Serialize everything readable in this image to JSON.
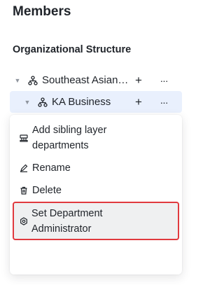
{
  "header": {
    "title": "Members"
  },
  "section": {
    "title": "Organizational Structure"
  },
  "tree": {
    "root": {
      "label": "Southeast Asian ...",
      "add": "+",
      "more": "···"
    },
    "child": {
      "label": "KA Business",
      "add": "+",
      "more": "···"
    }
  },
  "menu": {
    "items": [
      {
        "label_line1": "Add sibling layer",
        "label_line2": "departments",
        "icon": "sibling-department-icon"
      },
      {
        "label": "Rename",
        "icon": "pen-icon"
      },
      {
        "label": "Delete",
        "icon": "trash-icon"
      },
      {
        "label_line1": "Set Department",
        "label_line2": "Administrator",
        "icon": "settings-gear-icon",
        "highlighted": true
      }
    ]
  },
  "colors": {
    "selected_row_bg": "#e9f0fd",
    "highlight_border": "#e0393e",
    "hover_bg": "#eff0f1"
  }
}
